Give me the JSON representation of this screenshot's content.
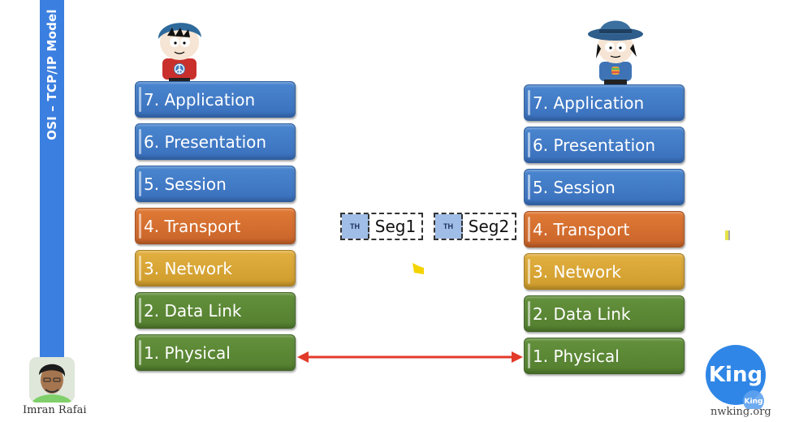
{
  "sidebar": {
    "title": "OSI – TCP/IP Model"
  },
  "left_stack": {
    "layers": [
      {
        "label": "7. Application",
        "color": "blue"
      },
      {
        "label": "6. Presentation",
        "color": "blue"
      },
      {
        "label": "5. Session",
        "color": "blue"
      },
      {
        "label": "4. Transport",
        "color": "orange"
      },
      {
        "label": "3. Network",
        "color": "yellow"
      },
      {
        "label": "2. Data Link",
        "color": "green"
      },
      {
        "label": "1. Physical",
        "color": "green"
      }
    ]
  },
  "right_stack": {
    "layers": [
      {
        "label": "7. Application",
        "color": "blue"
      },
      {
        "label": "6. Presentation",
        "color": "blue"
      },
      {
        "label": "5. Session",
        "color": "blue"
      },
      {
        "label": "4. Transport",
        "color": "orange"
      },
      {
        "label": "3. Network",
        "color": "yellow"
      },
      {
        "label": "2. Data Link",
        "color": "green"
      },
      {
        "label": "1. Physical",
        "color": "green"
      }
    ]
  },
  "segments": [
    {
      "header": "TH",
      "label": "Seg1"
    },
    {
      "header": "TH",
      "label": "Seg2"
    }
  ],
  "link": {
    "type": "bidirectional-arrow",
    "color": "#e23a2a"
  },
  "presenter": {
    "name": "Imran Rafai"
  },
  "logo": {
    "text": "King",
    "small_text": "King",
    "site": "nwking.org"
  },
  "colors": {
    "sidebar": "#3b7fe0",
    "blue": "#4a86cf",
    "orange": "#e07a36",
    "yellow": "#e2b040",
    "green": "#64913c",
    "segment_header": "#9fbde6"
  }
}
